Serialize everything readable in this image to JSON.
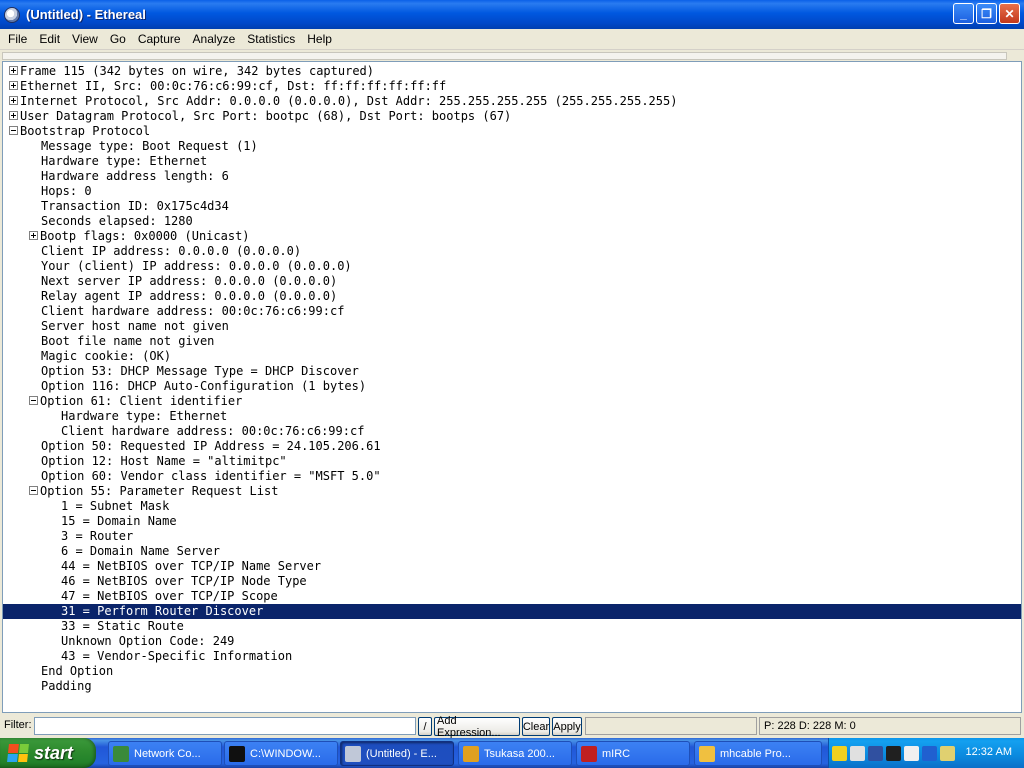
{
  "window": {
    "title": "(Untitled) - Ethereal",
    "controls": {
      "minimize": "_",
      "maximize": "❐",
      "close": "✕"
    }
  },
  "menu": [
    "File",
    "Edit",
    "View",
    "Go",
    "Capture",
    "Analyze",
    "Statistics",
    "Help"
  ],
  "tree": [
    {
      "indent": 0,
      "expander": "plus",
      "text": "Frame 115 (342 bytes on wire, 342 bytes captured)"
    },
    {
      "indent": 0,
      "expander": "plus",
      "text": "Ethernet II, Src: 00:0c:76:c6:99:cf, Dst: ff:ff:ff:ff:ff:ff"
    },
    {
      "indent": 0,
      "expander": "plus",
      "text": "Internet Protocol, Src Addr: 0.0.0.0 (0.0.0.0), Dst Addr: 255.255.255.255 (255.255.255.255)"
    },
    {
      "indent": 0,
      "expander": "plus",
      "text": "User Datagram Protocol, Src Port: bootpc (68), Dst Port: bootps (67)"
    },
    {
      "indent": 0,
      "expander": "minus",
      "text": "Bootstrap Protocol"
    },
    {
      "indent": 1,
      "expander": "",
      "text": "Message type: Boot Request (1)"
    },
    {
      "indent": 1,
      "expander": "",
      "text": "Hardware type: Ethernet"
    },
    {
      "indent": 1,
      "expander": "",
      "text": "Hardware address length: 6"
    },
    {
      "indent": 1,
      "expander": "",
      "text": "Hops: 0"
    },
    {
      "indent": 1,
      "expander": "",
      "text": "Transaction ID: 0x175c4d34"
    },
    {
      "indent": 1,
      "expander": "",
      "text": "Seconds elapsed: 1280"
    },
    {
      "indent": 1,
      "expander": "plus",
      "text": "Bootp flags: 0x0000 (Unicast)"
    },
    {
      "indent": 1,
      "expander": "",
      "text": "Client IP address: 0.0.0.0 (0.0.0.0)"
    },
    {
      "indent": 1,
      "expander": "",
      "text": "Your (client) IP address: 0.0.0.0 (0.0.0.0)"
    },
    {
      "indent": 1,
      "expander": "",
      "text": "Next server IP address: 0.0.0.0 (0.0.0.0)"
    },
    {
      "indent": 1,
      "expander": "",
      "text": "Relay agent IP address: 0.0.0.0 (0.0.0.0)"
    },
    {
      "indent": 1,
      "expander": "",
      "text": "Client hardware address: 00:0c:76:c6:99:cf"
    },
    {
      "indent": 1,
      "expander": "",
      "text": "Server host name not given"
    },
    {
      "indent": 1,
      "expander": "",
      "text": "Boot file name not given"
    },
    {
      "indent": 1,
      "expander": "",
      "text": "Magic cookie: (OK)"
    },
    {
      "indent": 1,
      "expander": "",
      "text": "Option 53: DHCP Message Type = DHCP Discover"
    },
    {
      "indent": 1,
      "expander": "",
      "text": "Option 116: DHCP Auto-Configuration (1 bytes)"
    },
    {
      "indent": 1,
      "expander": "minus",
      "text": "Option 61: Client identifier"
    },
    {
      "indent": 2,
      "expander": "",
      "text": "Hardware type: Ethernet"
    },
    {
      "indent": 2,
      "expander": "",
      "text": "Client hardware address: 00:0c:76:c6:99:cf"
    },
    {
      "indent": 1,
      "expander": "",
      "text": "Option 50: Requested IP Address = 24.105.206.61"
    },
    {
      "indent": 1,
      "expander": "",
      "text": "Option 12: Host Name = \"altimitpc\""
    },
    {
      "indent": 1,
      "expander": "",
      "text": "Option 60: Vendor class identifier = \"MSFT 5.0\""
    },
    {
      "indent": 1,
      "expander": "minus",
      "text": "Option 55: Parameter Request List"
    },
    {
      "indent": 2,
      "expander": "",
      "text": "1 = Subnet Mask"
    },
    {
      "indent": 2,
      "expander": "",
      "text": "15 = Domain Name"
    },
    {
      "indent": 2,
      "expander": "",
      "text": "3 = Router"
    },
    {
      "indent": 2,
      "expander": "",
      "text": "6 = Domain Name Server"
    },
    {
      "indent": 2,
      "expander": "",
      "text": "44 = NetBIOS over TCP/IP Name Server"
    },
    {
      "indent": 2,
      "expander": "",
      "text": "46 = NetBIOS over TCP/IP Node Type"
    },
    {
      "indent": 2,
      "expander": "",
      "text": "47 = NetBIOS over TCP/IP Scope"
    },
    {
      "indent": 2,
      "expander": "",
      "text": "31 = Perform Router Discover",
      "selected": true
    },
    {
      "indent": 2,
      "expander": "",
      "text": "33 = Static Route"
    },
    {
      "indent": 2,
      "expander": "",
      "text": "Unknown Option Code: 249"
    },
    {
      "indent": 2,
      "expander": "",
      "text": "43 = Vendor-Specific Information"
    },
    {
      "indent": 1,
      "expander": "",
      "text": "End Option"
    },
    {
      "indent": 1,
      "expander": "",
      "text": "Padding"
    }
  ],
  "filterbar": {
    "label": "Filter:",
    "value": "",
    "dropdown": "/",
    "add_expression": "Add Expression...",
    "clear": "Clear",
    "apply": "Apply",
    "status": "",
    "counts": "P: 228 D: 228 M: 0"
  },
  "taskbar": {
    "start": "start",
    "tasks": [
      {
        "label": "Network Co...",
        "icon_color": "#3A8A3A",
        "active": false
      },
      {
        "label": "C:\\WINDOW...",
        "icon_color": "#101010",
        "active": false
      },
      {
        "label": "(Untitled) - E...",
        "icon_color": "#C0C8D8",
        "active": true
      },
      {
        "label": "Tsukasa 200...",
        "icon_color": "#E0A020",
        "active": false
      },
      {
        "label": "mIRC",
        "icon_color": "#C02020",
        "active": false
      },
      {
        "label": "mhcable Pro...",
        "icon_color": "#F0C040",
        "active": false
      }
    ],
    "tray_icons": [
      "#F0D020",
      "#E0E0E0",
      "#3050A0",
      "#202020",
      "#F0F0F0",
      "#2060D0",
      "#E0D070"
    ],
    "clock": "12:32 AM"
  },
  "colors": {
    "selection": "#0A246A",
    "titlebar": "#0054E3",
    "taskbar": "#245EDC",
    "start": "#2F8C2F"
  }
}
